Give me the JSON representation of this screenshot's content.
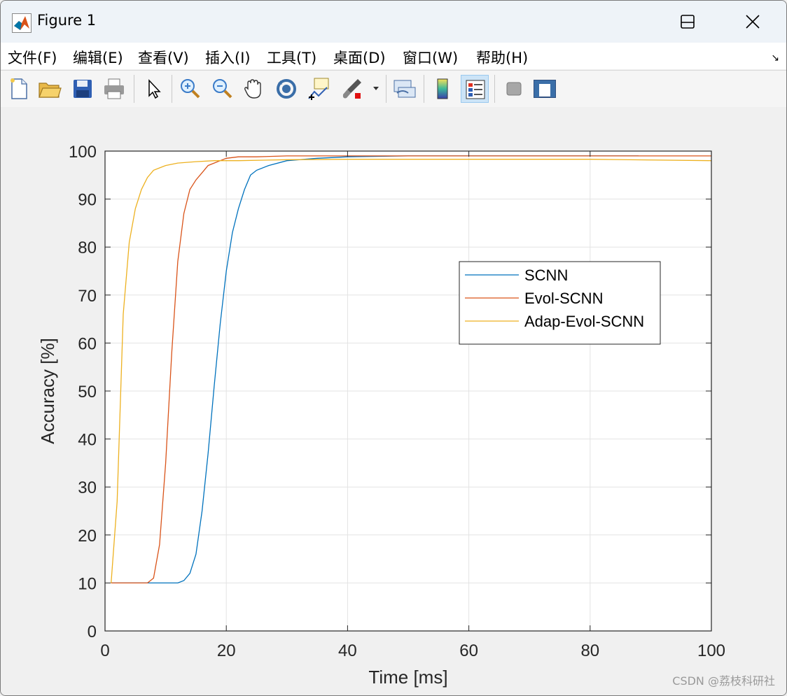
{
  "window": {
    "title": "Figure 1",
    "controls": {
      "minimize": "minimize",
      "maximize": "maximize",
      "close": "close"
    }
  },
  "menu": {
    "items": [
      "文件(F)",
      "编辑(E)",
      "查看(V)",
      "插入(I)",
      "工具(T)",
      "桌面(D)",
      "窗口(W)",
      "帮助(H)"
    ]
  },
  "toolbar": {
    "icons": [
      "new-file-icon",
      "open-folder-icon",
      "save-icon",
      "print-icon",
      "pointer-icon",
      "zoom-in-icon",
      "zoom-out-icon",
      "pan-hand-icon",
      "rotate-3d-icon",
      "data-cursor-icon",
      "brush-icon",
      "link-plot-icon",
      "colorbar-icon",
      "legend-icon",
      "hide-plot-tools-icon",
      "show-plot-tools-icon"
    ],
    "active": "legend-icon"
  },
  "watermark": "CSDN @荔枝科研社",
  "chart_data": {
    "type": "line",
    "title": "",
    "xlabel": "Time [ms]",
    "ylabel": "Accuracy [%]",
    "xlim": [
      0,
      100
    ],
    "ylim": [
      0,
      100
    ],
    "xticks": [
      0,
      20,
      40,
      60,
      80,
      100
    ],
    "yticks": [
      0,
      10,
      20,
      30,
      40,
      50,
      60,
      70,
      80,
      90,
      100
    ],
    "grid": true,
    "legend_position": "right-middle",
    "series": [
      {
        "name": "SCNN",
        "color": "#0072bd",
        "x": [
          1,
          12,
          13,
          14,
          15,
          16,
          17,
          18,
          19,
          20,
          21,
          22,
          23,
          24,
          25,
          27,
          30,
          35,
          40,
          50,
          60,
          70,
          80,
          88
        ],
        "y": [
          10,
          10,
          10.5,
          12,
          16,
          25,
          37,
          51,
          64,
          75,
          83,
          88,
          92,
          95,
          96,
          97,
          98,
          98.5,
          98.8,
          99,
          99,
          99,
          99,
          99
        ]
      },
      {
        "name": "Evol-SCNN",
        "color": "#d95319",
        "x": [
          1,
          7,
          8,
          9,
          10,
          11,
          12,
          13,
          14,
          15,
          16,
          17,
          18,
          19,
          20,
          22,
          25,
          30,
          40,
          50,
          60,
          70,
          80,
          90,
          100
        ],
        "y": [
          10,
          10,
          11,
          18,
          35,
          58,
          77,
          87,
          92,
          94,
          95.5,
          97,
          97.5,
          98,
          98.5,
          98.8,
          98.8,
          99,
          99,
          99,
          99,
          99,
          99,
          99,
          99
        ]
      },
      {
        "name": "Adap-Evol-SCNN",
        "color": "#edb120",
        "x": [
          1,
          2,
          3,
          4,
          5,
          6,
          7,
          8,
          9,
          10,
          12,
          15,
          18,
          22,
          30,
          40,
          60,
          80,
          100
        ],
        "y": [
          10,
          27,
          66,
          81,
          88,
          92,
          94.5,
          96,
          96.5,
          97,
          97.5,
          97.8,
          98,
          98,
          98.2,
          98.3,
          98.3,
          98.3,
          98
        ]
      }
    ]
  }
}
